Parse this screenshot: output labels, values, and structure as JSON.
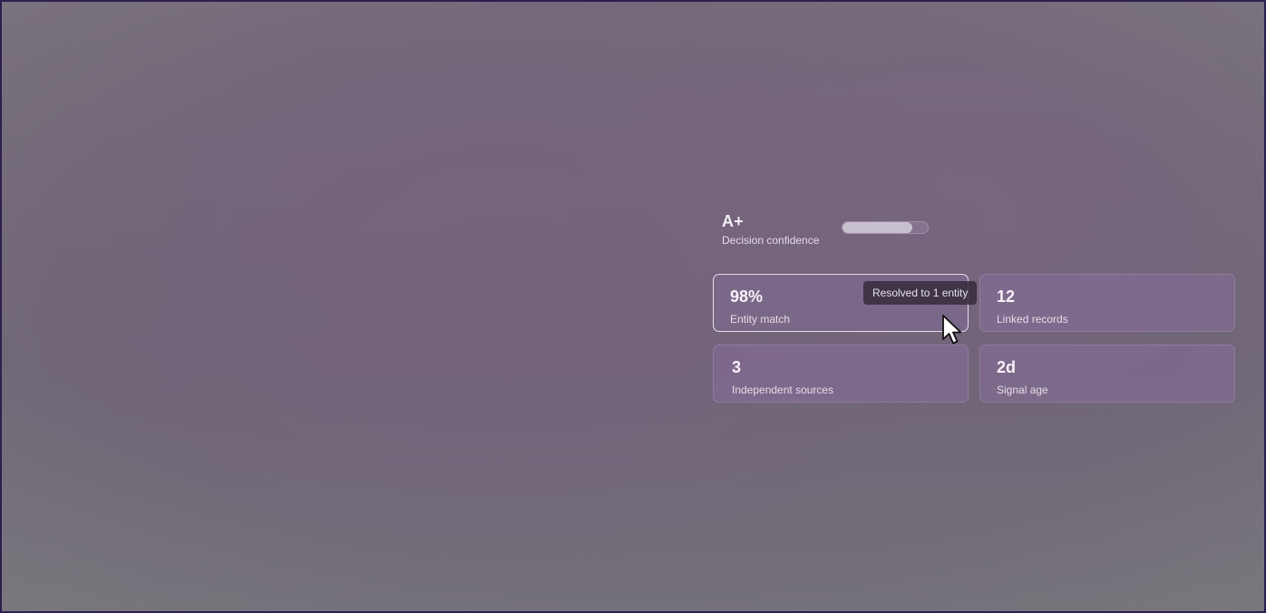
{
  "summary": {
    "grade": "A+",
    "caption": "Decision confidence",
    "confidence_level": 0.82
  },
  "metrics": [
    {
      "value": "98%",
      "label": "Entity match",
      "tooltip": "Resolved to 1 entity"
    },
    {
      "value": "12",
      "label": "Linked records"
    },
    {
      "value": "3",
      "label": "Independent sources"
    },
    {
      "value": "2d",
      "label": "Signal age"
    }
  ],
  "colors": {
    "frame": "#2d1f52",
    "card_background": "#876e9b",
    "tooltip_background": "#372d3e",
    "confidence_fill": "#c8bfcf"
  },
  "icons": {
    "cursor": "mouse-pointer-icon"
  }
}
